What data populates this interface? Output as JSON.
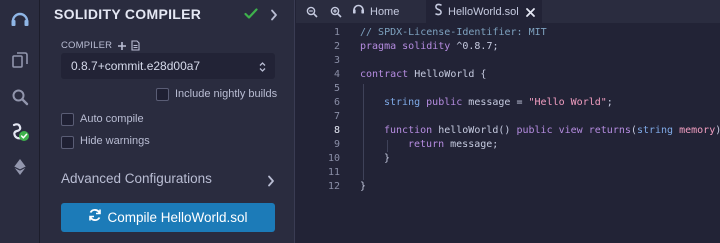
{
  "panel": {
    "title": "SOLIDITY COMPILER",
    "compiler_label": "COMPILER",
    "compiler_version": "0.8.7+commit.e28d00a7",
    "include_nightly_label": "Include nightly builds",
    "auto_compile_label": "Auto compile",
    "hide_warnings_label": "Hide warnings",
    "advanced_label": "Advanced Configurations",
    "compile_button_label": "Compile HelloWorld.sol"
  },
  "tabs": {
    "home_label": "Home",
    "active_label": "HelloWorld.sol"
  },
  "editor": {
    "line_numbers": [
      "1",
      "2",
      "3",
      "4",
      "5",
      "6",
      "7",
      "8",
      "9",
      "10",
      "11",
      "12"
    ],
    "current_line": "8",
    "line1": "// SPDX-License-Identifier: MIT",
    "line2_kw": "pragma",
    "line2_kw2": "solidity",
    "line2_rest": " ^0.8.7;",
    "line4_kw": "contract",
    "line4_rest": " HelloWorld {",
    "line6_type": "string",
    "line6_kw": "public",
    "line6_name": " message = ",
    "line6_str": "\"Hello World\"",
    "line6_end": ";",
    "line8_kw": "function",
    "line8_name": " helloWorld() ",
    "line8_kw2": "public",
    "line8_kw3": "view",
    "line8_kw4": "returns",
    "line8_paren": "(",
    "line8_type": "string",
    "line8_mem": "memory",
    "line8_end": "){",
    "line9_kw": "return",
    "line9_rest": " message;",
    "line10": "}",
    "line12": "}"
  },
  "icons": {
    "rail": [
      "remix-logo-icon",
      "file-explorer-icon",
      "search-icon",
      "solidity-compiler-icon",
      "deploy-icon"
    ],
    "status_badge_color": "#3eb14c",
    "compile_button_color": "#1c7bb8"
  }
}
